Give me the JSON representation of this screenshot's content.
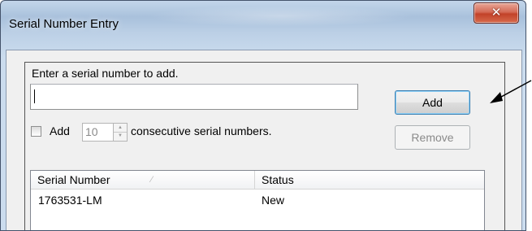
{
  "window": {
    "title": "Serial Number Entry",
    "close_icon": "close-x-icon",
    "close_color": "#c8452c"
  },
  "form": {
    "prompt_label": "Enter a serial number to add.",
    "serial_input_value": "",
    "add_button_label": "Add",
    "remove_button_label": "Remove",
    "consecutive_checkbox_checked": false,
    "consecutive_add_label": "Add",
    "consecutive_count": "10",
    "consecutive_suffix_label": "consecutive serial numbers."
  },
  "list": {
    "columns": [
      "Serial Number",
      "Status"
    ],
    "rows": [
      {
        "serial": "1763531-LM",
        "status": "New"
      }
    ]
  },
  "annotation": {
    "arrow_icon": "pointer-arrow-icon"
  }
}
